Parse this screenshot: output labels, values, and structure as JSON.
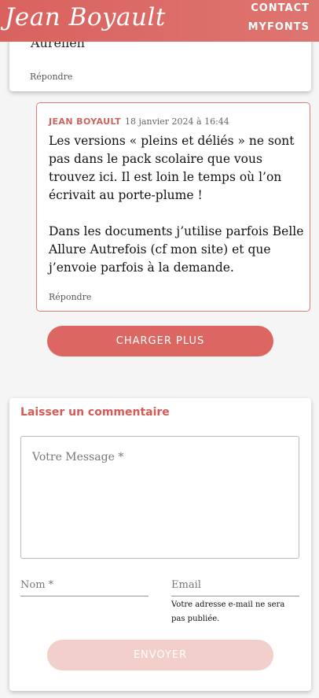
{
  "header": {
    "logo": "Jean Boyault",
    "nav": {
      "contact": "CONTACT",
      "myfonts": "MYFONTS"
    }
  },
  "previous_comment": {
    "text_tail": "Aurélien",
    "reply_label": "Répondre"
  },
  "reply_comment": {
    "author": "JEAN BOYAULT",
    "date": "18 janvier 2024 à 16:44",
    "paragraphs": [
      "Les versions « pleins et déliés » ne sont pas dans le pack scolaire que vous trouvez ici. Il est loin le temps où l’on écrivait au porte-plume !",
      "Dans les documents j’utilise parfois Belle Allure Autrefois (cf mon site) et que j’envoie parfois à la demande."
    ],
    "reply_label": "Répondre"
  },
  "load_more_label": "CHARGER PLUS",
  "comment_form": {
    "title": "Laisser un commentaire",
    "message_placeholder": "Votre Message *",
    "name_placeholder": "Nom *",
    "email_placeholder": "Email",
    "email_note": "Votre adresse e-mail ne sera pas publiée.",
    "submit_label": "ENVOYER"
  },
  "colors": {
    "accent": "#dc6762",
    "submit_disabled": "#f3cfcc"
  }
}
